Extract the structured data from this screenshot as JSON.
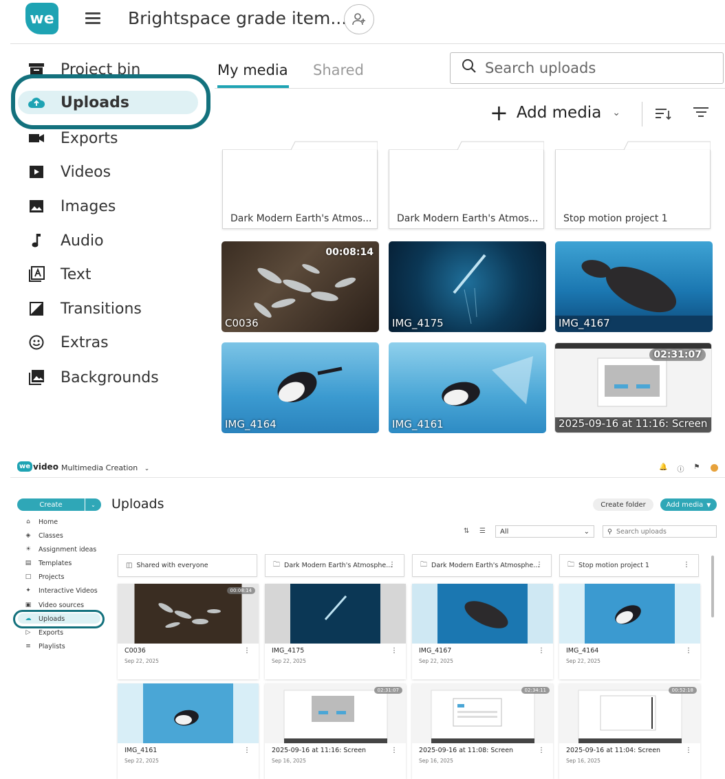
{
  "top": {
    "logo_text": "we",
    "project_title": "Brightspace grade item...",
    "sidebar": [
      {
        "label": "Project bin",
        "icon": "bin-icon"
      },
      {
        "label": "Uploads",
        "icon": "cloud-upload-icon"
      },
      {
        "label": "Exports",
        "icon": "camera-icon"
      },
      {
        "label": "Videos",
        "icon": "play-icon"
      },
      {
        "label": "Images",
        "icon": "image-icon"
      },
      {
        "label": "Audio",
        "icon": "music-note-icon"
      },
      {
        "label": "Text",
        "icon": "text-icon"
      },
      {
        "label": "Transitions",
        "icon": "transition-icon"
      },
      {
        "label": "Extras",
        "icon": "smiley-icon"
      },
      {
        "label": "Backgrounds",
        "icon": "background-icon"
      }
    ],
    "tabs": {
      "my_media": "My media",
      "shared": "Shared"
    },
    "search_placeholder": "Search uploads",
    "add_media": "Add media",
    "folders": [
      "Dark Modern Earth's Atmos...",
      "Dark Modern Earth's Atmos...",
      "Stop motion project 1"
    ],
    "media": [
      {
        "label": "C0036",
        "duration": "00:08:14"
      },
      {
        "label": "IMG_4175",
        "duration": ""
      },
      {
        "label": "IMG_4167",
        "duration": ""
      },
      {
        "label": "IMG_4164",
        "duration": ""
      },
      {
        "label": "IMG_4161",
        "duration": ""
      },
      {
        "label": "2025-09-16 at 11:16: Screen",
        "duration": "02:31:07"
      }
    ]
  },
  "bottom": {
    "logo_we": "we",
    "logo_video": "video",
    "workspace": "Multimedia Creation",
    "create": "Create",
    "sidebar": [
      {
        "label": "Home",
        "icon": "home-icon"
      },
      {
        "label": "Classes",
        "icon": "classes-icon"
      },
      {
        "label": "Assignment ideas",
        "icon": "lightbulb-icon"
      },
      {
        "label": "Templates",
        "icon": "templates-icon"
      },
      {
        "label": "Projects",
        "icon": "folder-icon"
      },
      {
        "label": "Interactive Videos",
        "icon": "interactive-icon"
      },
      {
        "label": "Video sources",
        "icon": "video-source-icon"
      },
      {
        "label": "Uploads",
        "icon": "cloud-upload-icon"
      },
      {
        "label": "Exports",
        "icon": "export-icon"
      },
      {
        "label": "Playlists",
        "icon": "playlist-icon"
      }
    ],
    "page_title": "Uploads",
    "create_folder": "Create folder",
    "add_media": "Add media",
    "filter_value": "All",
    "search_placeholder": "Search uploads",
    "folders": [
      {
        "label": "Shared with everyone",
        "icon": "shared-folder-icon"
      },
      {
        "label": "Dark Modern Earth's Atmosphe...",
        "icon": "folder-icon"
      },
      {
        "label": "Dark Modern Earth's Atmosphe...",
        "icon": "folder-icon"
      },
      {
        "label": "Stop motion project 1",
        "icon": "folder-icon"
      }
    ],
    "cards": [
      {
        "name": "C0036",
        "date": "Sep 22, 2025",
        "duration": "00:08:14"
      },
      {
        "name": "IMG_4175",
        "date": "Sep 22, 2025",
        "duration": ""
      },
      {
        "name": "IMG_4167",
        "date": "Sep 22, 2025",
        "duration": ""
      },
      {
        "name": "IMG_4164",
        "date": "Sep 22, 2025",
        "duration": ""
      },
      {
        "name": "IMG_4161",
        "date": "Sep 22, 2025",
        "duration": ""
      },
      {
        "name": "2025-09-16 at 11:16: Screen",
        "date": "Sep 16, 2025",
        "duration": "02:31:07"
      },
      {
        "name": "2025-09-16 at 11:08: Screen",
        "date": "Sep 16, 2025",
        "duration": "02:34:11"
      },
      {
        "name": "2025-09-16 at 11:04: Screen",
        "date": "Sep 16, 2025",
        "duration": "00:52:18"
      }
    ]
  }
}
